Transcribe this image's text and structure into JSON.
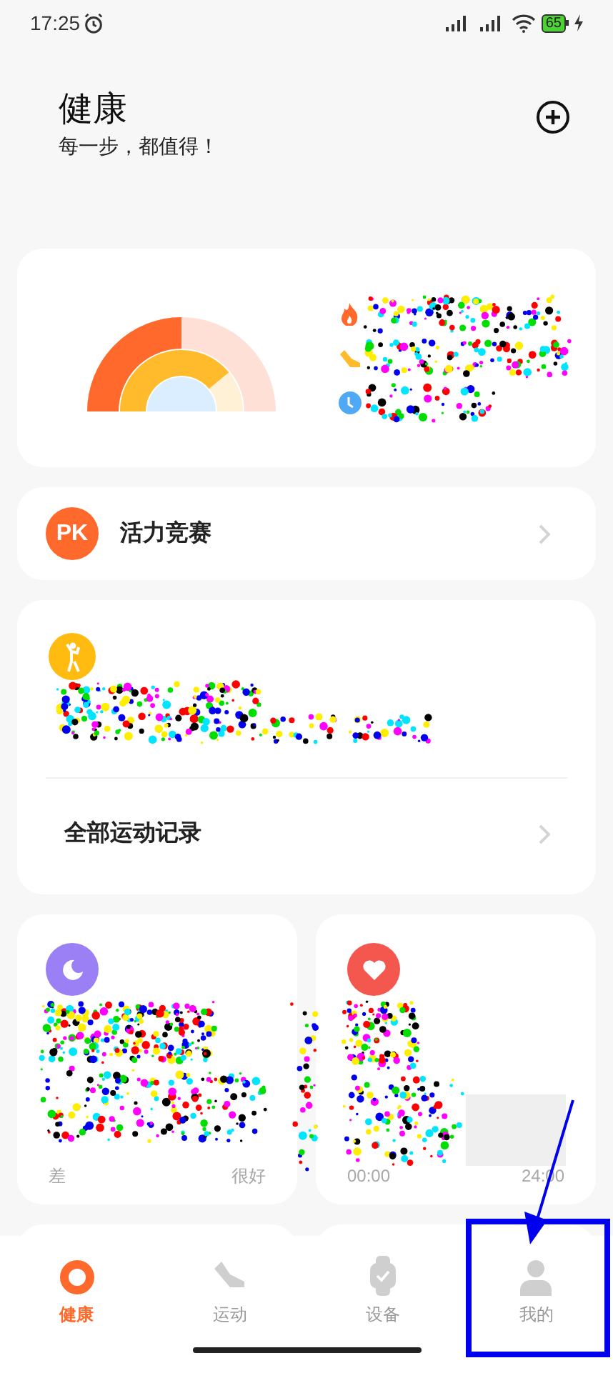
{
  "status_bar": {
    "time": "17:25",
    "battery": "65"
  },
  "header": {
    "title": "健康",
    "subtitle": "每一步，都值得！"
  },
  "pk_card": {
    "badge": "PK",
    "label": "活力竞赛"
  },
  "workout_card": {
    "link": "全部运动记录"
  },
  "sleep_card": {
    "axis_labels": [
      "差",
      "很好"
    ]
  },
  "heart_card": {
    "axis_labels": [
      "00:00",
      "24:00"
    ]
  },
  "tabs": [
    {
      "label": "健康",
      "selected": true
    },
    {
      "label": "运动",
      "selected": false
    },
    {
      "label": "设备",
      "selected": false
    },
    {
      "label": "我的",
      "selected": false
    }
  ]
}
